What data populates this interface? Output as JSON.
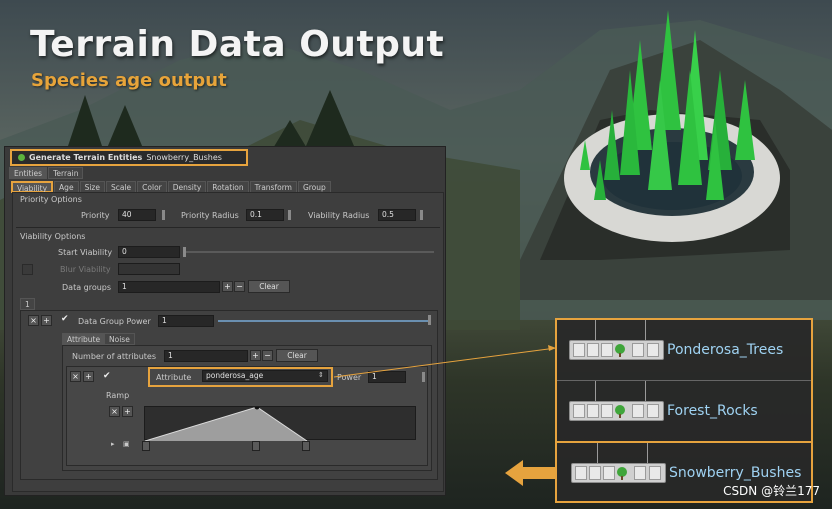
{
  "slide": {
    "title": "Terrain Data Output",
    "subtitle": "Species age output"
  },
  "panel": {
    "node_header_label": "Generate Terrain Entities",
    "node_header_value": "Snowberry_Bushes",
    "top_tabs": [
      "Entities",
      "Terrain"
    ],
    "sub_tabs": [
      "Viability",
      "Age",
      "Size",
      "Scale",
      "Color",
      "Density",
      "Rotation",
      "Transform",
      "Group"
    ],
    "priority_options": {
      "section": "Priority Options",
      "priority_label": "Priority",
      "priority_value": "40",
      "priority_radius_label": "Priority Radius",
      "priority_radius_value": "0.1",
      "viability_radius_label": "Viability Radius",
      "viability_radius_value": "0.5"
    },
    "viability_options": {
      "section": "Viability Options",
      "start_viability_label": "Start Viability",
      "start_viability_value": "0",
      "blur_viability_label": "Blur Viability",
      "data_groups_label": "Data groups",
      "data_groups_value": "1",
      "clear_label": "Clear",
      "tab_1": "1"
    },
    "data_group": {
      "power_label": "Data Group Power",
      "power_value": "1",
      "tabs": [
        "Attribute",
        "Noise"
      ],
      "num_attributes_label": "Number of attributes",
      "num_attributes_value": "1",
      "clear_label": "Clear",
      "attribute_label": "Attribute",
      "attribute_value": "ponderosa_age",
      "attr_power_label": "Power",
      "attr_power_value": "1",
      "ramp_label": "Ramp"
    }
  },
  "node_list": {
    "items": [
      {
        "name": "Ponderosa_Trees"
      },
      {
        "name": "Forest_Rocks"
      },
      {
        "name": "Snowberry_Bushes"
      }
    ]
  },
  "watermark": "CSDN @铃兰177",
  "colors": {
    "accent_orange": "#e6a33e",
    "node_name_blue": "#9fd2f2",
    "tree_green": "#2fc240"
  }
}
